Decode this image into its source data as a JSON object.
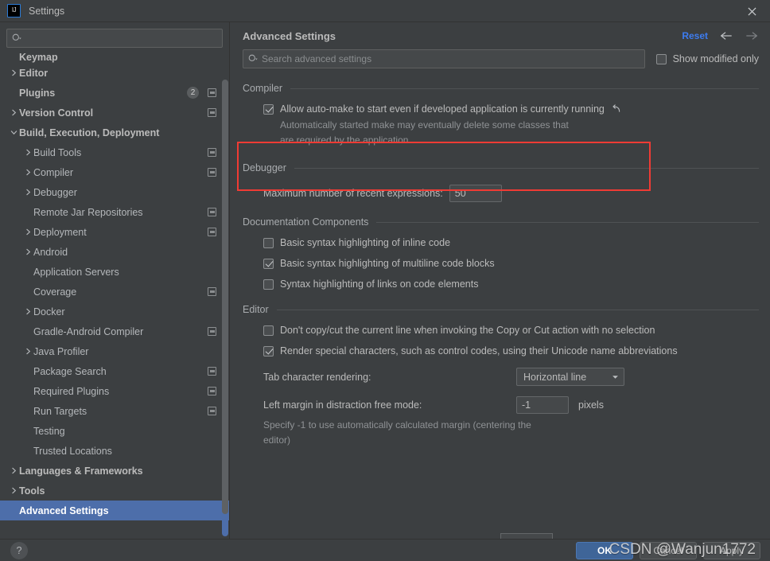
{
  "window": {
    "title": "Settings",
    "logo_icon": "intellij-idea-logo",
    "close_icon": "close-icon"
  },
  "sidebar": {
    "search": {
      "placeholder": "",
      "value": "",
      "icon": "search-icon"
    },
    "items": [
      {
        "label": "Keymap",
        "indent": 1,
        "bold": true,
        "caret": false,
        "badge": null,
        "icon": false,
        "selected": false,
        "clipped": true
      },
      {
        "label": "Editor",
        "indent": 1,
        "bold": true,
        "caret": true,
        "caret_dir": "right",
        "badge": null,
        "icon": false,
        "selected": false
      },
      {
        "label": "Plugins",
        "indent": 1,
        "bold": true,
        "caret": false,
        "badge": "2",
        "icon": true,
        "selected": false
      },
      {
        "label": "Version Control",
        "indent": 1,
        "bold": true,
        "caret": true,
        "caret_dir": "right",
        "badge": null,
        "icon": true,
        "selected": false
      },
      {
        "label": "Build, Execution, Deployment",
        "indent": 1,
        "bold": true,
        "caret": true,
        "caret_dir": "down",
        "badge": null,
        "icon": false,
        "selected": false
      },
      {
        "label": "Build Tools",
        "indent": 2,
        "bold": false,
        "caret": true,
        "caret_dir": "right",
        "badge": null,
        "icon": true,
        "selected": false
      },
      {
        "label": "Compiler",
        "indent": 2,
        "bold": false,
        "caret": true,
        "caret_dir": "right",
        "badge": null,
        "icon": true,
        "selected": false
      },
      {
        "label": "Debugger",
        "indent": 2,
        "bold": false,
        "caret": true,
        "caret_dir": "right",
        "badge": null,
        "icon": false,
        "selected": false
      },
      {
        "label": "Remote Jar Repositories",
        "indent": 2,
        "bold": false,
        "caret": false,
        "badge": null,
        "icon": true,
        "selected": false
      },
      {
        "label": "Deployment",
        "indent": 2,
        "bold": false,
        "caret": true,
        "caret_dir": "right",
        "badge": null,
        "icon": true,
        "selected": false
      },
      {
        "label": "Android",
        "indent": 2,
        "bold": false,
        "caret": true,
        "caret_dir": "right",
        "badge": null,
        "icon": false,
        "selected": false
      },
      {
        "label": "Application Servers",
        "indent": 2,
        "bold": false,
        "caret": false,
        "badge": null,
        "icon": false,
        "selected": false
      },
      {
        "label": "Coverage",
        "indent": 2,
        "bold": false,
        "caret": false,
        "badge": null,
        "icon": true,
        "selected": false
      },
      {
        "label": "Docker",
        "indent": 2,
        "bold": false,
        "caret": true,
        "caret_dir": "right",
        "badge": null,
        "icon": false,
        "selected": false
      },
      {
        "label": "Gradle-Android Compiler",
        "indent": 2,
        "bold": false,
        "caret": false,
        "badge": null,
        "icon": true,
        "selected": false
      },
      {
        "label": "Java Profiler",
        "indent": 2,
        "bold": false,
        "caret": true,
        "caret_dir": "right",
        "badge": null,
        "icon": false,
        "selected": false
      },
      {
        "label": "Package Search",
        "indent": 2,
        "bold": false,
        "caret": false,
        "badge": null,
        "icon": true,
        "selected": false
      },
      {
        "label": "Required Plugins",
        "indent": 2,
        "bold": false,
        "caret": false,
        "badge": null,
        "icon": true,
        "selected": false
      },
      {
        "label": "Run Targets",
        "indent": 2,
        "bold": false,
        "caret": false,
        "badge": null,
        "icon": true,
        "selected": false
      },
      {
        "label": "Testing",
        "indent": 2,
        "bold": false,
        "caret": false,
        "badge": null,
        "icon": false,
        "selected": false
      },
      {
        "label": "Trusted Locations",
        "indent": 2,
        "bold": false,
        "caret": false,
        "badge": null,
        "icon": false,
        "selected": false
      },
      {
        "label": "Languages & Frameworks",
        "indent": 1,
        "bold": true,
        "caret": true,
        "caret_dir": "right",
        "badge": null,
        "icon": false,
        "selected": false
      },
      {
        "label": "Tools",
        "indent": 1,
        "bold": true,
        "caret": true,
        "caret_dir": "right",
        "badge": null,
        "icon": false,
        "selected": false
      },
      {
        "label": "Advanced Settings",
        "indent": 1,
        "bold": true,
        "caret": false,
        "badge": null,
        "icon": false,
        "selected": true
      }
    ]
  },
  "main": {
    "title": "Advanced Settings",
    "reset_label": "Reset",
    "back_icon": "arrow-left-icon",
    "forward_icon": "arrow-right-icon",
    "search": {
      "placeholder": "Search advanced settings",
      "value": "",
      "icon": "search-icon"
    },
    "show_modified_only": {
      "label": "Show modified only",
      "checked": false
    },
    "sections": [
      {
        "name": "Compiler",
        "highlighted": true,
        "options": [
          {
            "type": "checkbox",
            "label": "Allow auto-make to start even if developed application is currently running",
            "checked": true,
            "revert_icon": "revert-icon",
            "description": "Automatically started make may eventually delete some classes that are required by the application"
          }
        ]
      },
      {
        "name": "Debugger",
        "highlighted": false,
        "options": [
          {
            "type": "text-field",
            "label": "Maximum number of recent expressions:",
            "value": "50"
          }
        ]
      },
      {
        "name": "Documentation Components",
        "highlighted": false,
        "options": [
          {
            "type": "checkbox",
            "label": "Basic syntax highlighting of inline code",
            "checked": false
          },
          {
            "type": "checkbox",
            "label": "Basic syntax highlighting of multiline code blocks",
            "checked": true
          },
          {
            "type": "checkbox",
            "label": "Syntax highlighting of links on code elements",
            "checked": false
          }
        ]
      },
      {
        "name": "Editor",
        "highlighted": false,
        "options": [
          {
            "type": "checkbox",
            "label": "Don't copy/cut the current line when invoking the Copy or Cut action with no selection",
            "checked": false
          },
          {
            "type": "checkbox",
            "label": "Render special characters, such as control codes, using their Unicode name abbreviations",
            "checked": true
          },
          {
            "type": "combo",
            "label": "Tab character rendering:",
            "value": "Horizontal line"
          },
          {
            "type": "text-field-suffix",
            "label": "Left margin in distraction free mode:",
            "value": "-1",
            "suffix": "pixels",
            "description": "Specify -1 to use automatically calculated margin (centering the editor)"
          }
        ]
      }
    ]
  },
  "bottom": {
    "help_label": "?",
    "ok_label": "OK",
    "cancel_label": "Cancel",
    "apply_label": "Apply",
    "watermark": "CSDN @Wanjun1772"
  },
  "colors": {
    "background": "#3c3f41",
    "accent_link": "#3d7cf0",
    "selection": "#4d6eaa",
    "highlight_border": "#f03b34",
    "primary_button": "#3f6598"
  }
}
